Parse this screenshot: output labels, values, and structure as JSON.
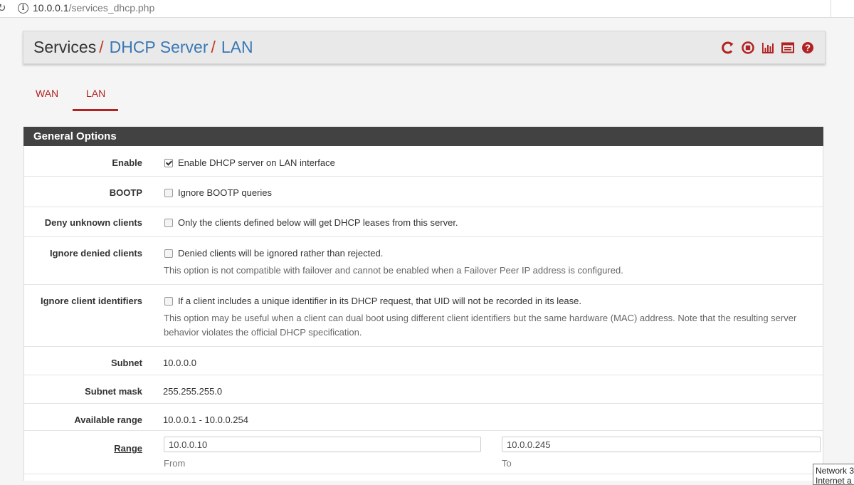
{
  "browser": {
    "url_host": "10.0.0.1",
    "url_path": "/services_dhcp.php"
  },
  "breadcrumb": {
    "first": "Services",
    "sep1": "/",
    "second": "DHCP Server",
    "sep2": "/",
    "third": "LAN"
  },
  "header_icons": [
    "restart-service-icon",
    "stop-service-icon",
    "status-graph-icon",
    "log-icon",
    "help-icon"
  ],
  "tabs": [
    {
      "label": "WAN",
      "active": false
    },
    {
      "label": "LAN",
      "active": true
    }
  ],
  "panel": {
    "title": "General Options",
    "enable": {
      "label": "Enable",
      "checked": true,
      "text": "Enable DHCP server on LAN interface"
    },
    "bootp": {
      "label": "BOOTP",
      "checked": false,
      "text": "Ignore BOOTP queries"
    },
    "deny_unknown": {
      "label": "Deny unknown clients",
      "checked": false,
      "text": "Only the clients defined below will get DHCP leases from this server."
    },
    "ignore_denied": {
      "label": "Ignore denied clients",
      "checked": false,
      "text": "Denied clients will be ignored rather than rejected.",
      "help": "This option is not compatible with failover and cannot be enabled when a Failover Peer IP address is configured."
    },
    "ignore_client_ids": {
      "label": "Ignore client identifiers",
      "checked": false,
      "text": "If a client includes a unique identifier in its DHCP request, that UID will not be recorded in its lease.",
      "help": "This option may be useful when a client can dual boot using different client identifiers but the same hardware (MAC) address. Note that the resulting server behavior violates the official DHCP specification."
    },
    "subnet": {
      "label": "Subnet",
      "value": "10.0.0.0"
    },
    "subnet_mask": {
      "label": "Subnet mask",
      "value": "255.255.255.0"
    },
    "available_range": {
      "label": "Available range",
      "value": "10.0.0.1 - 10.0.0.254"
    },
    "range": {
      "label": "Range",
      "from_value": "10.0.0.10",
      "from_label": "From",
      "to_value": "10.0.0.245",
      "to_label": "To"
    }
  },
  "tooltip": {
    "text": "Network 3 Internet a"
  },
  "colors": {
    "accent": "#b22222",
    "link": "#3a78b5",
    "panel_header": "#424242"
  }
}
